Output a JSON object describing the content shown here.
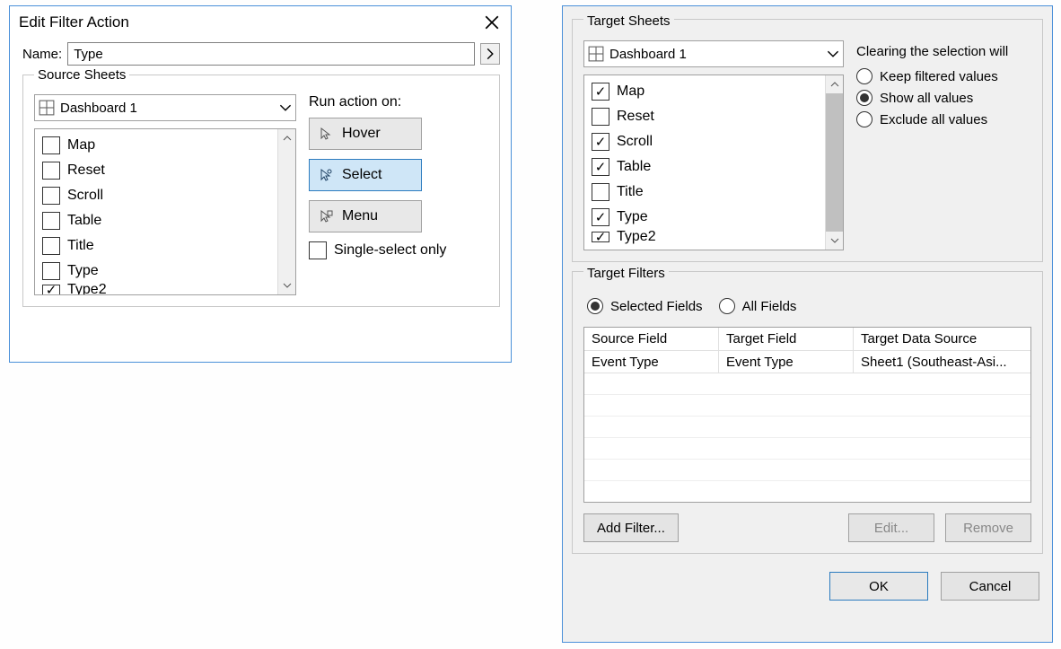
{
  "left_dialog": {
    "title": "Edit Filter Action",
    "name_label": "Name:",
    "name_value": "Type",
    "source_sheets_label": "Source Sheets",
    "dashboard": "Dashboard 1",
    "sheets": [
      {
        "label": "Map",
        "checked": false
      },
      {
        "label": "Reset",
        "checked": false
      },
      {
        "label": "Scroll",
        "checked": false
      },
      {
        "label": "Table",
        "checked": false
      },
      {
        "label": "Title",
        "checked": false
      },
      {
        "label": "Type",
        "checked": false
      },
      {
        "label": "Type2",
        "checked": true
      }
    ],
    "run_action_label": "Run action on:",
    "actions": {
      "hover": "Hover",
      "select": "Select",
      "menu": "Menu"
    },
    "single_select_label": "Single-select only"
  },
  "right_dialog": {
    "target_sheets_label": "Target Sheets",
    "dashboard": "Dashboard 1",
    "sheets": [
      {
        "label": "Map",
        "checked": true
      },
      {
        "label": "Reset",
        "checked": false
      },
      {
        "label": "Scroll",
        "checked": true
      },
      {
        "label": "Table",
        "checked": true
      },
      {
        "label": "Title",
        "checked": false
      },
      {
        "label": "Type",
        "checked": true
      },
      {
        "label": "Type2",
        "checked": true
      }
    ],
    "clearing_label": "Clearing the selection will",
    "clearing_options": {
      "keep": "Keep filtered values",
      "show": "Show all values",
      "exclude": "Exclude all values"
    },
    "target_filters_label": "Target Filters",
    "filter_mode": {
      "selected": "Selected Fields",
      "all": "All Fields"
    },
    "table": {
      "headers": {
        "source": "Source Field",
        "target": "Target Field",
        "ds": "Target Data Source"
      },
      "row": {
        "source": "Event Type",
        "target": "Event Type",
        "ds": "Sheet1 (Southeast-Asi..."
      }
    },
    "buttons": {
      "add": "Add Filter...",
      "edit": "Edit...",
      "remove": "Remove",
      "ok": "OK",
      "cancel": "Cancel"
    }
  }
}
